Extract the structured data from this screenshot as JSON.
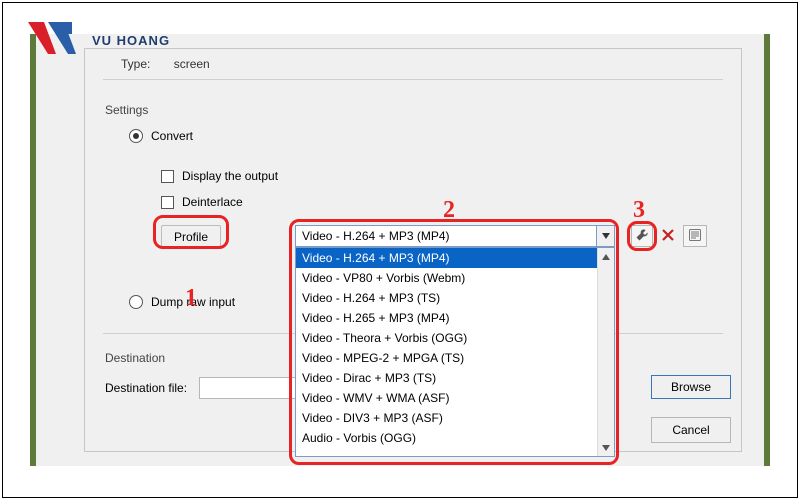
{
  "logo_text": "VU HOANG",
  "type": {
    "label": "Type:",
    "value": "screen"
  },
  "settings_label": "Settings",
  "convert_label": "Convert",
  "display_output_label": "Display the output",
  "deinterlace_label": "Deinterlace",
  "profile_label": "Profile",
  "combo_selected": "Video - H.264 + MP3 (MP4)",
  "profile_options": [
    "Video - H.264 + MP3 (MP4)",
    "Video - VP80 + Vorbis (Webm)",
    "Video - H.264 + MP3 (TS)",
    "Video - H.265 + MP3 (MP4)",
    "Video - Theora + Vorbis (OGG)",
    "Video - MPEG-2 + MPGA (TS)",
    "Video - Dirac + MP3 (TS)",
    "Video - WMV + WMA (ASF)",
    "Video - DIV3 + MP3 (ASF)",
    "Audio - Vorbis (OGG)"
  ],
  "dump_label": "Dump raw input",
  "destination_label": "Destination",
  "destination_file_label": "Destination file:",
  "destination_file_value": "",
  "browse_label": "Browse",
  "cancel_label": "Cancel",
  "annotations": {
    "n1": "1",
    "n2": "2",
    "n3": "3"
  },
  "colors": {
    "highlight": "#e82323",
    "select_bg": "#0a64c6"
  }
}
